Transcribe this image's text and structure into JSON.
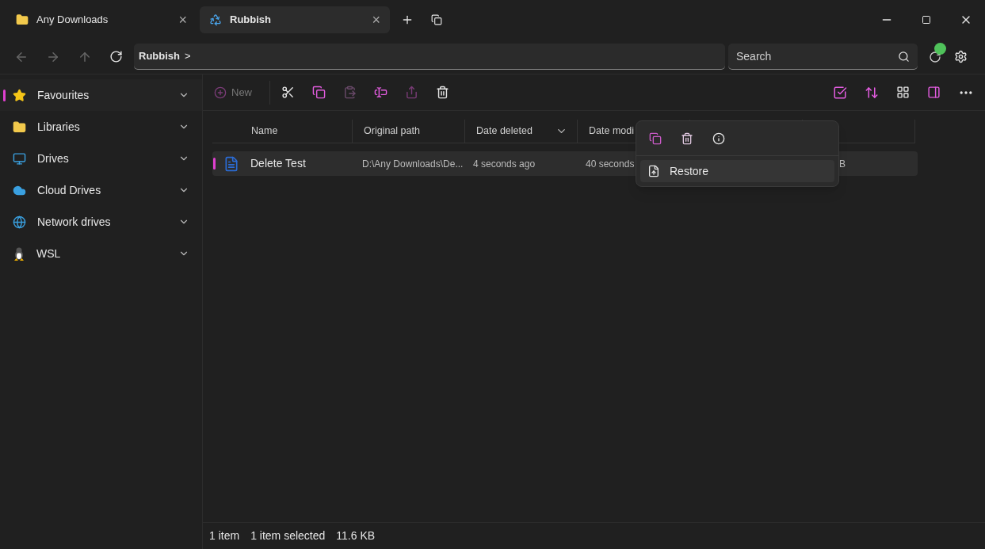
{
  "tabs": [
    {
      "label": "Any Downloads",
      "kind": "folder",
      "selected": false,
      "close": "×"
    },
    {
      "label": "Rubbish",
      "kind": "bin",
      "selected": true,
      "close": "×"
    }
  ],
  "address": {
    "crumb": "Rubbish",
    "separator": ">"
  },
  "search": {
    "placeholder": "Search"
  },
  "sidebar": {
    "items": [
      {
        "label": "Favourites",
        "kind": "star",
        "selected": true
      },
      {
        "label": "Libraries",
        "kind": "folder",
        "selected": false
      },
      {
        "label": "Drives",
        "kind": "monitor",
        "selected": false
      },
      {
        "label": "Cloud Drives",
        "kind": "cloud",
        "selected": false
      },
      {
        "label": "Network drives",
        "kind": "network",
        "selected": false
      },
      {
        "label": "WSL",
        "kind": "penguin",
        "selected": false
      }
    ]
  },
  "toolbar": {
    "new_label": "New"
  },
  "table": {
    "columns": [
      "Name",
      "Original path",
      "Date deleted",
      "Date modi"
    ],
    "rows": [
      {
        "selected": true,
        "name": "Delete Test",
        "original_path": "D:\\Any Downloads\\De...",
        "date_deleted": "4 seconds ago",
        "date_modified": "40 seconds",
        "column_5": "B"
      }
    ]
  },
  "context_menu": {
    "items": [
      {
        "label": "Restore"
      }
    ]
  },
  "status_bar": {
    "count": "1 item",
    "selection": "1 item selected",
    "size": "11.6 KB"
  }
}
